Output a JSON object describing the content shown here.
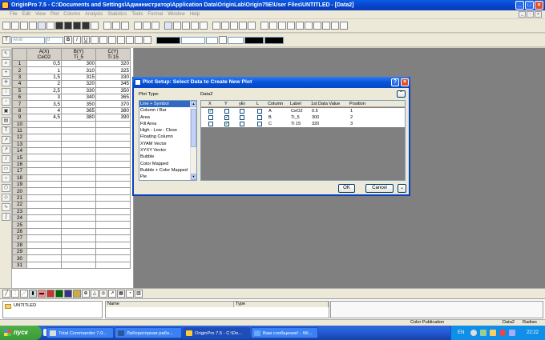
{
  "app": {
    "title": "OriginPro 7.5 - C:\\Documents and Settings\\Администратор\\Application Data\\OriginLab\\Origin75E\\User Files\\UNTITLED - [Data2]"
  },
  "menu": [
    "File",
    "Edit",
    "View",
    "Plot",
    "Column",
    "Analysis",
    "Statistics",
    "Tools",
    "Format",
    "Window",
    "Help"
  ],
  "format_toolbar": {
    "font": "Arial",
    "size": "8",
    "bold": "B",
    "italic": "I",
    "underline": "U"
  },
  "worksheet": {
    "columns": [
      {
        "name": "A(X)",
        "label": "CeO2"
      },
      {
        "name": "B(Y)",
        "label": "Ti_5"
      },
      {
        "name": "C(Y)",
        "label": "Ti 15"
      }
    ],
    "rows": [
      {
        "n": "1",
        "a": "0,5",
        "b": "300",
        "c": "320"
      },
      {
        "n": "2",
        "a": "1",
        "b": "310",
        "c": "325"
      },
      {
        "n": "3",
        "a": "1,5",
        "b": "315",
        "c": "330"
      },
      {
        "n": "4",
        "a": "2",
        "b": "320",
        "c": "345"
      },
      {
        "n": "5",
        "a": "2,5",
        "b": "330",
        "c": "350"
      },
      {
        "n": "6",
        "a": "3",
        "b": "340",
        "c": "365"
      },
      {
        "n": "7",
        "a": "3,5",
        "b": "350",
        "c": "370"
      },
      {
        "n": "8",
        "a": "4",
        "b": "365",
        "c": "380"
      },
      {
        "n": "9",
        "a": "4,5",
        "b": "380",
        "c": "390"
      },
      {
        "n": "10"
      },
      {
        "n": "11"
      },
      {
        "n": "12"
      },
      {
        "n": "13"
      },
      {
        "n": "14"
      },
      {
        "n": "15"
      },
      {
        "n": "16"
      },
      {
        "n": "17"
      },
      {
        "n": "18"
      },
      {
        "n": "19"
      },
      {
        "n": "20"
      },
      {
        "n": "21"
      },
      {
        "n": "22"
      },
      {
        "n": "23"
      },
      {
        "n": "24"
      },
      {
        "n": "25"
      },
      {
        "n": "26"
      },
      {
        "n": "27"
      },
      {
        "n": "28"
      },
      {
        "n": "29"
      },
      {
        "n": "30"
      },
      {
        "n": "31"
      }
    ]
  },
  "dialog": {
    "title": "Plot Setup: Select Data to Create New Plot",
    "plot_type_label": "Plot Type:",
    "dataset_label": "Data2",
    "plot_types": [
      "Line + Symbol",
      "Column / Bar",
      "Area",
      "Fill Area",
      "High - Low - Close",
      "Floating Column",
      "XYAM Vector",
      "XYXY Vector",
      "Bubble",
      "Color Mapped",
      "Bubble + Color Mapped",
      "Pie"
    ],
    "selected_plot_type": "Line + Symbol",
    "grid_headers": [
      "X",
      "Y",
      "yEr",
      "L",
      "Column",
      "Label",
      "1st Data Value",
      "Position"
    ],
    "grid_rows": [
      {
        "x": true,
        "y": false,
        "yer": false,
        "l": false,
        "column": "A",
        "label": "CeO2",
        "first": "0.5",
        "position": "1"
      },
      {
        "x": false,
        "y": true,
        "yer": false,
        "l": false,
        "column": "B",
        "label": "Ti_5",
        "first": "300",
        "position": "2"
      },
      {
        "x": false,
        "y": true,
        "yer": false,
        "l": false,
        "column": "C",
        "label": "Ti 15",
        "first": "320",
        "position": "3"
      }
    ],
    "ok_label": "OK",
    "cancel_label": "Cancel"
  },
  "explorer": {
    "folder": "UNTITLED",
    "col_name": "Name",
    "col_type": "Type"
  },
  "status": {
    "color_mode": "Color Publication",
    "window": "Data2",
    "angle": "Radian"
  },
  "taskbar": {
    "start": "пуск",
    "tasks": [
      "Total Commander 7.0...",
      "Лабораторная рабо...",
      "OriginPro 7.5 - C:\\Do...",
      "Вам сообщение! - Wi..."
    ],
    "lang": "EN",
    "time": "22:22"
  },
  "colors": {
    "xp_title": "#0a5ce6",
    "selection": "#316ac5",
    "check": "#21a121"
  }
}
